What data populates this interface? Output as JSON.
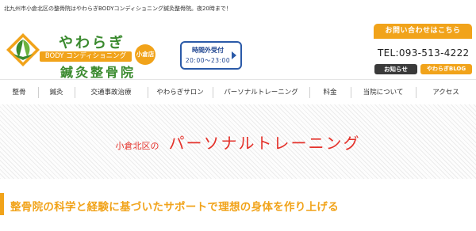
{
  "header": {
    "tagline": "北九州市小倉北区の整骨院はやわらぎBODYコンディショニング鍼灸整骨院。夜20時まで！",
    "logo": {
      "name_top": "やわらぎ",
      "name_bar": "BODY コンディショニング",
      "name_bottom": "鍼灸整骨院",
      "badge": "小倉店"
    },
    "hours": {
      "line1": "時間外受付",
      "line2": "20:00～23:00"
    },
    "contact_label": "お問い合わせはこちら",
    "tel": "TEL:093-513-4222",
    "notice_label": "お知らせ",
    "blog_label": "やわらぎBLOG"
  },
  "nav": {
    "items": [
      "整骨",
      "鍼灸",
      "交通事故治療",
      "やわらぎサロン",
      "パーソナルトレーニング",
      "料金",
      "当院について",
      "アクセス"
    ]
  },
  "hero": {
    "prefix": "小倉北区の",
    "title": "パーソナルトレーニング"
  },
  "section": {
    "heading": "整骨院の科学と経験に基づいたサポートで理想の身体を作り上げる"
  },
  "colors": {
    "accent_orange": "#f1a31a",
    "brand_green": "#3a8a2e",
    "hero_red": "#e4322b",
    "hours_blue": "#2b5aa8"
  }
}
